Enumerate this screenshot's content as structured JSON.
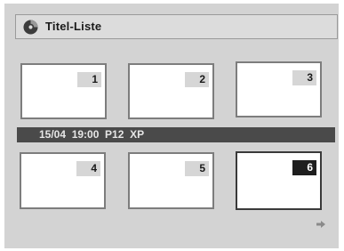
{
  "header": {
    "title": "Titel-Liste",
    "icon": "disc-icon"
  },
  "titles": [
    {
      "number": "1",
      "selected": false
    },
    {
      "number": "2",
      "selected": false
    },
    {
      "number": "3",
      "selected": false
    },
    {
      "number": "4",
      "selected": false
    },
    {
      "number": "5",
      "selected": false
    },
    {
      "number": "6",
      "selected": true
    }
  ],
  "info_bar": {
    "text": "15/04  19:00  P12  XP"
  },
  "navigation": {
    "next_icon": "arrow-right-icon"
  }
}
